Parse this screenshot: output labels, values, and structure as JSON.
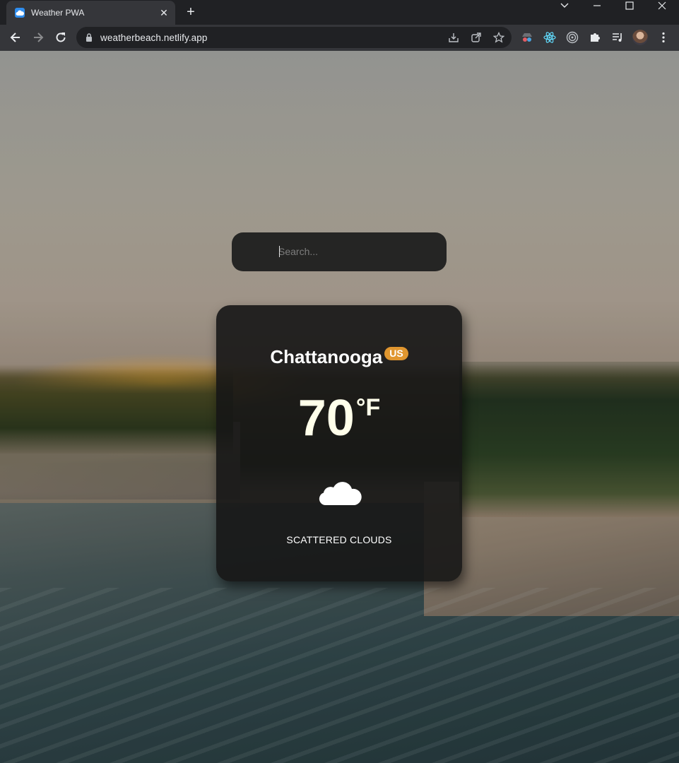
{
  "browser": {
    "tab": {
      "title": "Weather PWA",
      "close": "✕",
      "favicon": "cloud-favicon-icon"
    },
    "new_tab": "+",
    "url": "weatherbeach.netlify.app",
    "window_controls": [
      "tab-search",
      "minimize",
      "maximize",
      "close"
    ],
    "toolbar_icons": [
      "back",
      "forward",
      "reload"
    ],
    "omnibox_icons": [
      "install-app",
      "share",
      "bookmark-star"
    ],
    "extensions": [
      "spy-extension",
      "react-devtools",
      "circle-extension",
      "puzzle-extensions",
      "media-control",
      "profile-avatar",
      "more-menu"
    ]
  },
  "app": {
    "search": {
      "placeholder": "Search...",
      "value": ""
    },
    "city": "Chattanooga",
    "country": "US",
    "temperature": "70",
    "unit": "°F",
    "condition_icon": "cloud-icon",
    "condition": "SCATTERED CLOUDS"
  },
  "colors": {
    "badge": "#e0962f",
    "temperature_text": "#ffffea",
    "card_bg": "#161616"
  }
}
